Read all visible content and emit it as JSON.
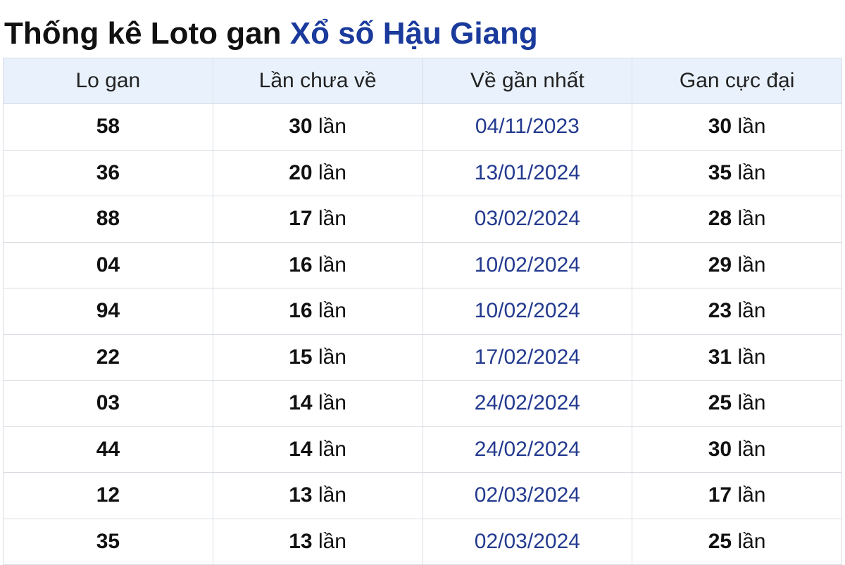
{
  "title": {
    "prefix": "Thống kê Loto gan",
    "link": "Xổ số Hậu Giang"
  },
  "colors": {
    "link": "#1a3a9c",
    "date": "#233a8f",
    "header_bg": "#e9f2fc",
    "border": "#d9dde3"
  },
  "table": {
    "headers": [
      "Lo gan",
      "Lần chưa về",
      "Về gần nhất",
      "Gan cực đại"
    ],
    "unit": "lần",
    "rows": [
      {
        "lo": "58",
        "chua_ve": "30",
        "gan_nhat": "04/11/2023",
        "cuc_dai": "30"
      },
      {
        "lo": "36",
        "chua_ve": "20",
        "gan_nhat": "13/01/2024",
        "cuc_dai": "35"
      },
      {
        "lo": "88",
        "chua_ve": "17",
        "gan_nhat": "03/02/2024",
        "cuc_dai": "28"
      },
      {
        "lo": "04",
        "chua_ve": "16",
        "gan_nhat": "10/02/2024",
        "cuc_dai": "29"
      },
      {
        "lo": "94",
        "chua_ve": "16",
        "gan_nhat": "10/02/2024",
        "cuc_dai": "23"
      },
      {
        "lo": "22",
        "chua_ve": "15",
        "gan_nhat": "17/02/2024",
        "cuc_dai": "31"
      },
      {
        "lo": "03",
        "chua_ve": "14",
        "gan_nhat": "24/02/2024",
        "cuc_dai": "25"
      },
      {
        "lo": "44",
        "chua_ve": "14",
        "gan_nhat": "24/02/2024",
        "cuc_dai": "30"
      },
      {
        "lo": "12",
        "chua_ve": "13",
        "gan_nhat": "02/03/2024",
        "cuc_dai": "17"
      },
      {
        "lo": "35",
        "chua_ve": "13",
        "gan_nhat": "02/03/2024",
        "cuc_dai": "25"
      }
    ]
  }
}
